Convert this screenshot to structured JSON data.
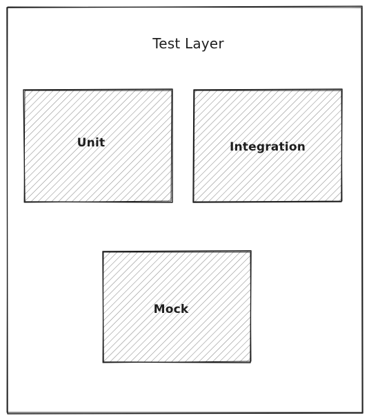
{
  "diagram": {
    "title": "Test Layer",
    "nodes": [
      {
        "id": "unit",
        "label": "Unit"
      },
      {
        "id": "integration",
        "label": "Integration"
      },
      {
        "id": "mock",
        "label": "Mock"
      }
    ],
    "colors": {
      "stroke": "#1e1e1e",
      "hatch": "#8a8a8a",
      "background": "#ffffff"
    }
  }
}
